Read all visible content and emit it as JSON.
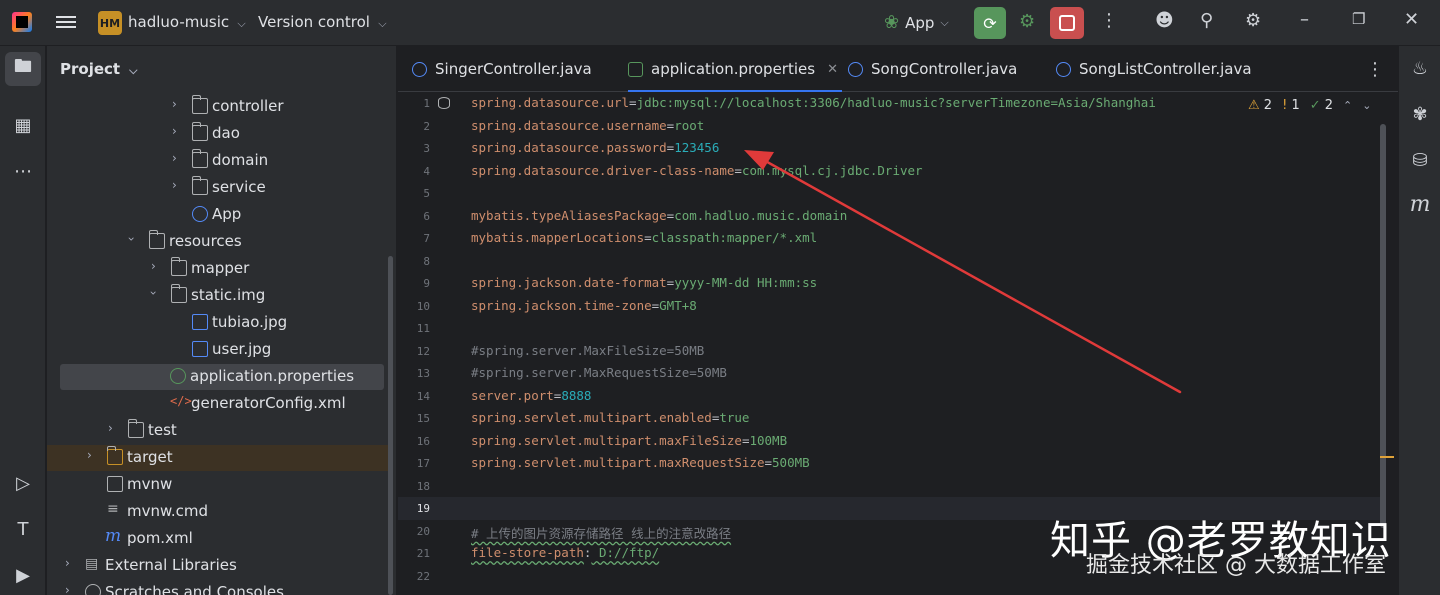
{
  "titlebar": {
    "project_badge": "HM",
    "project_name": "hadluo-music",
    "vcs": "Version control",
    "run_config": "App"
  },
  "project_panel": {
    "title": "Project",
    "items": [
      {
        "label": "controller",
        "kind": "folder"
      },
      {
        "label": "dao",
        "kind": "folder"
      },
      {
        "label": "domain",
        "kind": "folder"
      },
      {
        "label": "service",
        "kind": "folder"
      },
      {
        "label": "App",
        "kind": "class"
      },
      {
        "label": "resources",
        "kind": "folder"
      },
      {
        "label": "mapper",
        "kind": "folder"
      },
      {
        "label": "static.img",
        "kind": "folder"
      },
      {
        "label": "tubiao.jpg",
        "kind": "image"
      },
      {
        "label": "user.jpg",
        "kind": "image"
      },
      {
        "label": "application.properties",
        "kind": "properties"
      },
      {
        "label": "generatorConfig.xml",
        "kind": "xml"
      },
      {
        "label": "test",
        "kind": "folder"
      },
      {
        "label": "target",
        "kind": "folder"
      },
      {
        "label": "mvnw",
        "kind": "file"
      },
      {
        "label": "mvnw.cmd",
        "kind": "file"
      },
      {
        "label": "pom.xml",
        "kind": "maven"
      },
      {
        "label": "External Libraries",
        "kind": "library"
      },
      {
        "label": "Scratches and Consoles",
        "kind": "scratch"
      }
    ]
  },
  "tabs": [
    {
      "label": "SingerController.java",
      "active": false
    },
    {
      "label": "application.properties",
      "active": true
    },
    {
      "label": "SongController.java",
      "active": false
    },
    {
      "label": "SongListController.java",
      "active": false
    }
  ],
  "inspections": {
    "warnings": "2",
    "weak_warnings": "1",
    "ok": "2"
  },
  "code": [
    {
      "n": "1",
      "k": "spring.datasource.url",
      "v": "jdbc:mysql://localhost:3306/hadluo-music?serverTimezone=Asia/Shanghai"
    },
    {
      "n": "2",
      "k": "spring.datasource.username",
      "v": "root"
    },
    {
      "n": "3",
      "k": "spring.datasource.password",
      "v": "123456"
    },
    {
      "n": "4",
      "k": "spring.datasource.driver-class-name",
      "v": "com.mysql.cj.jdbc.Driver"
    },
    {
      "n": "5",
      "k": "",
      "v": ""
    },
    {
      "n": "6",
      "k": "mybatis.typeAliasesPackage",
      "v": "com.hadluo.music.domain"
    },
    {
      "n": "7",
      "k": "mybatis.mapperLocations",
      "v": "classpath:mapper/*.xml"
    },
    {
      "n": "8",
      "k": "",
      "v": ""
    },
    {
      "n": "9",
      "k": "spring.jackson.date-format",
      "v": "yyyy-MM-dd HH:mm:ss"
    },
    {
      "n": "10",
      "k": "spring.jackson.time-zone",
      "v": "GMT+8"
    },
    {
      "n": "11",
      "k": "",
      "v": ""
    },
    {
      "n": "12",
      "c": "#spring.server.MaxFileSize=50MB"
    },
    {
      "n": "13",
      "c": "#spring.server.MaxRequestSize=50MB"
    },
    {
      "n": "14",
      "k": "server.port",
      "v": "8888"
    },
    {
      "n": "15",
      "k": "spring.servlet.multipart.enabled",
      "v": "true"
    },
    {
      "n": "16",
      "k": "spring.servlet.multipart.maxFileSize",
      "v": "100MB"
    },
    {
      "n": "17",
      "k": "spring.servlet.multipart.maxRequestSize",
      "v": "500MB"
    },
    {
      "n": "18",
      "k": "",
      "v": ""
    },
    {
      "n": "19",
      "k": "",
      "v": ""
    },
    {
      "n": "20",
      "c": "# 上传的图片资源存储路径 线上的注意改路径"
    },
    {
      "n": "21",
      "k": "file-store-path",
      "v": " D://ftp/"
    },
    {
      "n": "22",
      "k": "",
      "v": ""
    }
  ],
  "watermark": {
    "line1": "知乎 @老罗教知识",
    "line2": "掘金技术社区 @ 大数据工作室"
  },
  "colors": {
    "accent": "#3574f0",
    "run": "#57965c",
    "stop": "#c94f4f",
    "annotation_arrow": "#e03a3a"
  }
}
